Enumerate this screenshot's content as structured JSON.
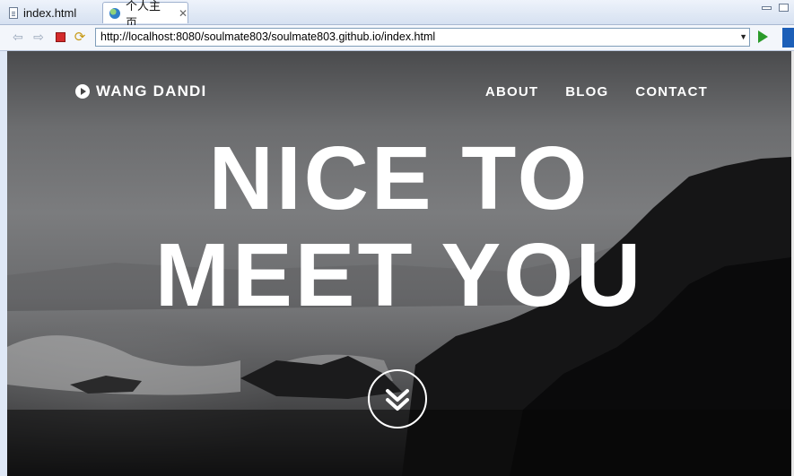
{
  "tabs": [
    {
      "label": "index.html"
    },
    {
      "label": "个人主页"
    }
  ],
  "toolbar": {
    "url": "http://localhost:8080/soulmate803/soulmate803.github.io/index.html"
  },
  "page": {
    "brand": {
      "first": "WANG",
      "last": "DANDI"
    },
    "nav": [
      "ABOUT",
      "BLOG",
      "CONTACT"
    ],
    "headline": [
      "NICE TO",
      "MEET YOU"
    ]
  },
  "icons": {
    "brand": "play-circle-icon",
    "scroll": "double-chevron-down-icon"
  }
}
